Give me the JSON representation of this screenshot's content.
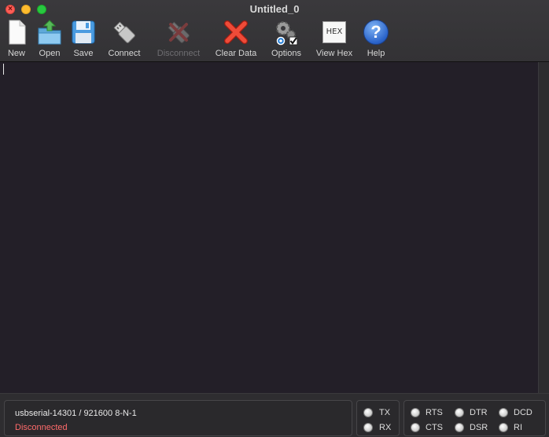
{
  "window": {
    "title": "Untitled_0"
  },
  "toolbar": [
    {
      "name": "new",
      "label": "New",
      "icon": "new-file-icon",
      "enabled": true
    },
    {
      "name": "open",
      "label": "Open",
      "icon": "open-folder-icon",
      "enabled": true
    },
    {
      "name": "save",
      "label": "Save",
      "icon": "floppy-icon",
      "enabled": true
    },
    {
      "name": "connect",
      "label": "Connect",
      "icon": "usb-plug-icon",
      "enabled": true
    },
    {
      "name": "disconnect",
      "label": "Disconnect",
      "icon": "usb-unplug-icon",
      "enabled": false
    },
    {
      "name": "clear-data",
      "label": "Clear Data",
      "icon": "red-x-icon",
      "enabled": true
    },
    {
      "name": "options",
      "label": "Options",
      "icon": "gears-icon",
      "enabled": true
    },
    {
      "name": "view-hex",
      "label": "View Hex",
      "icon": "hex-icon",
      "icon_text": "HEX",
      "enabled": true
    },
    {
      "name": "help",
      "label": "Help",
      "icon": "question-icon",
      "icon_text": "?",
      "enabled": true
    }
  ],
  "status": {
    "port": "usbserial-14301 / 921600 8-N-1",
    "state": "Disconnected",
    "state_color": "#ff6b6b",
    "signals": {
      "tx": "TX",
      "rx": "RX",
      "rts": "RTS",
      "cts": "CTS",
      "dtr": "DTR",
      "dsr": "DSR",
      "dcd": "DCD",
      "ri": "RI"
    }
  }
}
